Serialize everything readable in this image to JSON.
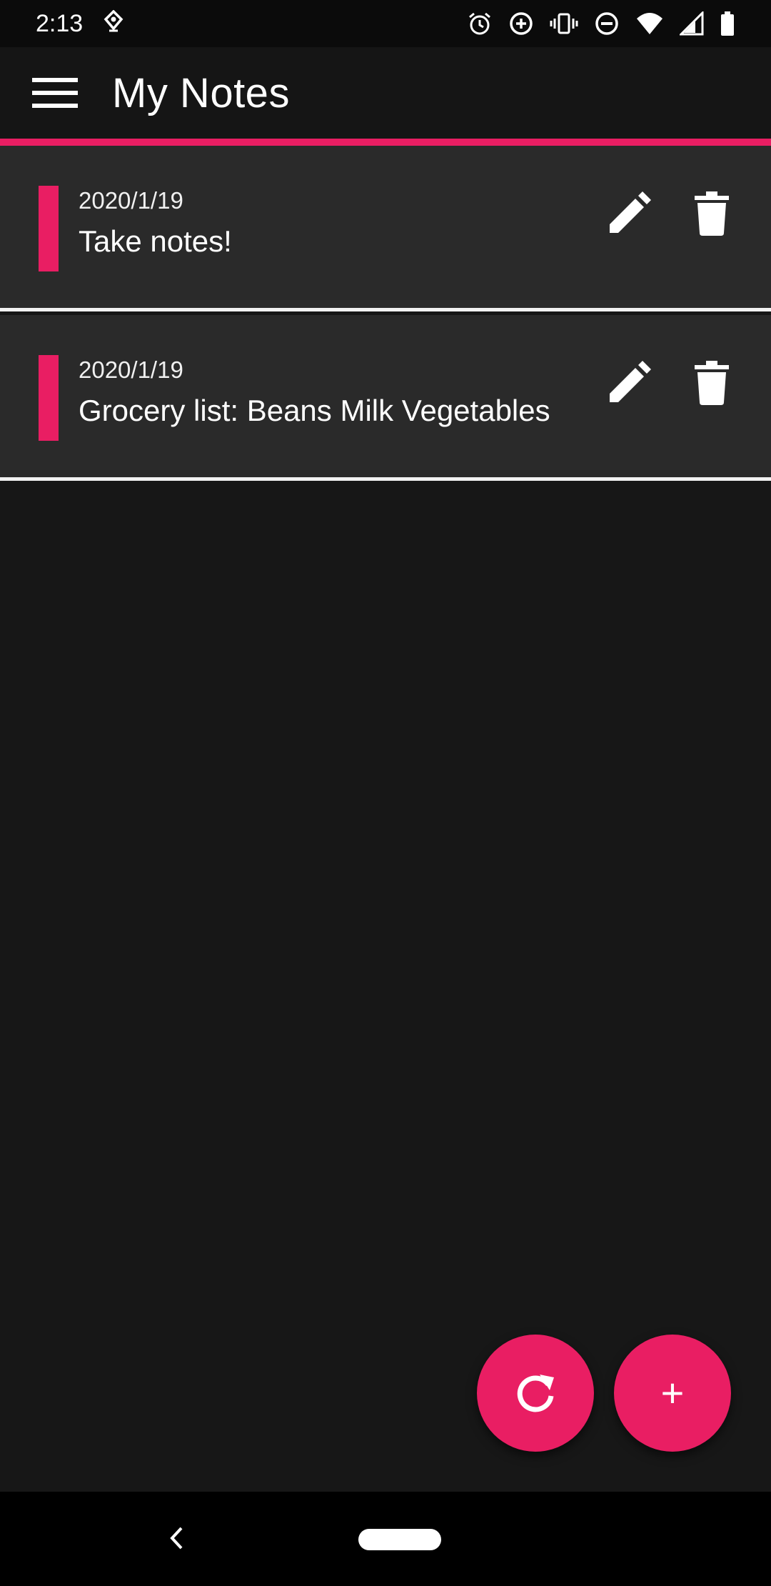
{
  "status_bar": {
    "time": "2:13",
    "left_icons": [
      "location-pin-icon"
    ],
    "right_icons": [
      "alarm-icon",
      "data-saver-icon",
      "vibrate-icon",
      "do-not-disturb-icon",
      "wifi-icon",
      "cellular-signal-icon",
      "battery-icon"
    ]
  },
  "app_bar": {
    "title": "My Notes",
    "menu_icon": "hamburger-menu-icon"
  },
  "colors": {
    "accent": "#e91e63",
    "background": "#171717",
    "card": "#2a2a2a",
    "text": "#ffffff"
  },
  "notes": [
    {
      "date": "2020/1/19",
      "text": "Take notes!"
    },
    {
      "date": "2020/1/19",
      "text": "Grocery list: Beans Milk Vegetables"
    }
  ],
  "note_actions": [
    "edit-icon",
    "delete-icon"
  ],
  "fabs": {
    "refresh_icon": "refresh-icon",
    "add_symbol": "+"
  },
  "nav_bar": {
    "back_icon": "back-chevron-icon",
    "home_pill": "home-pill"
  }
}
